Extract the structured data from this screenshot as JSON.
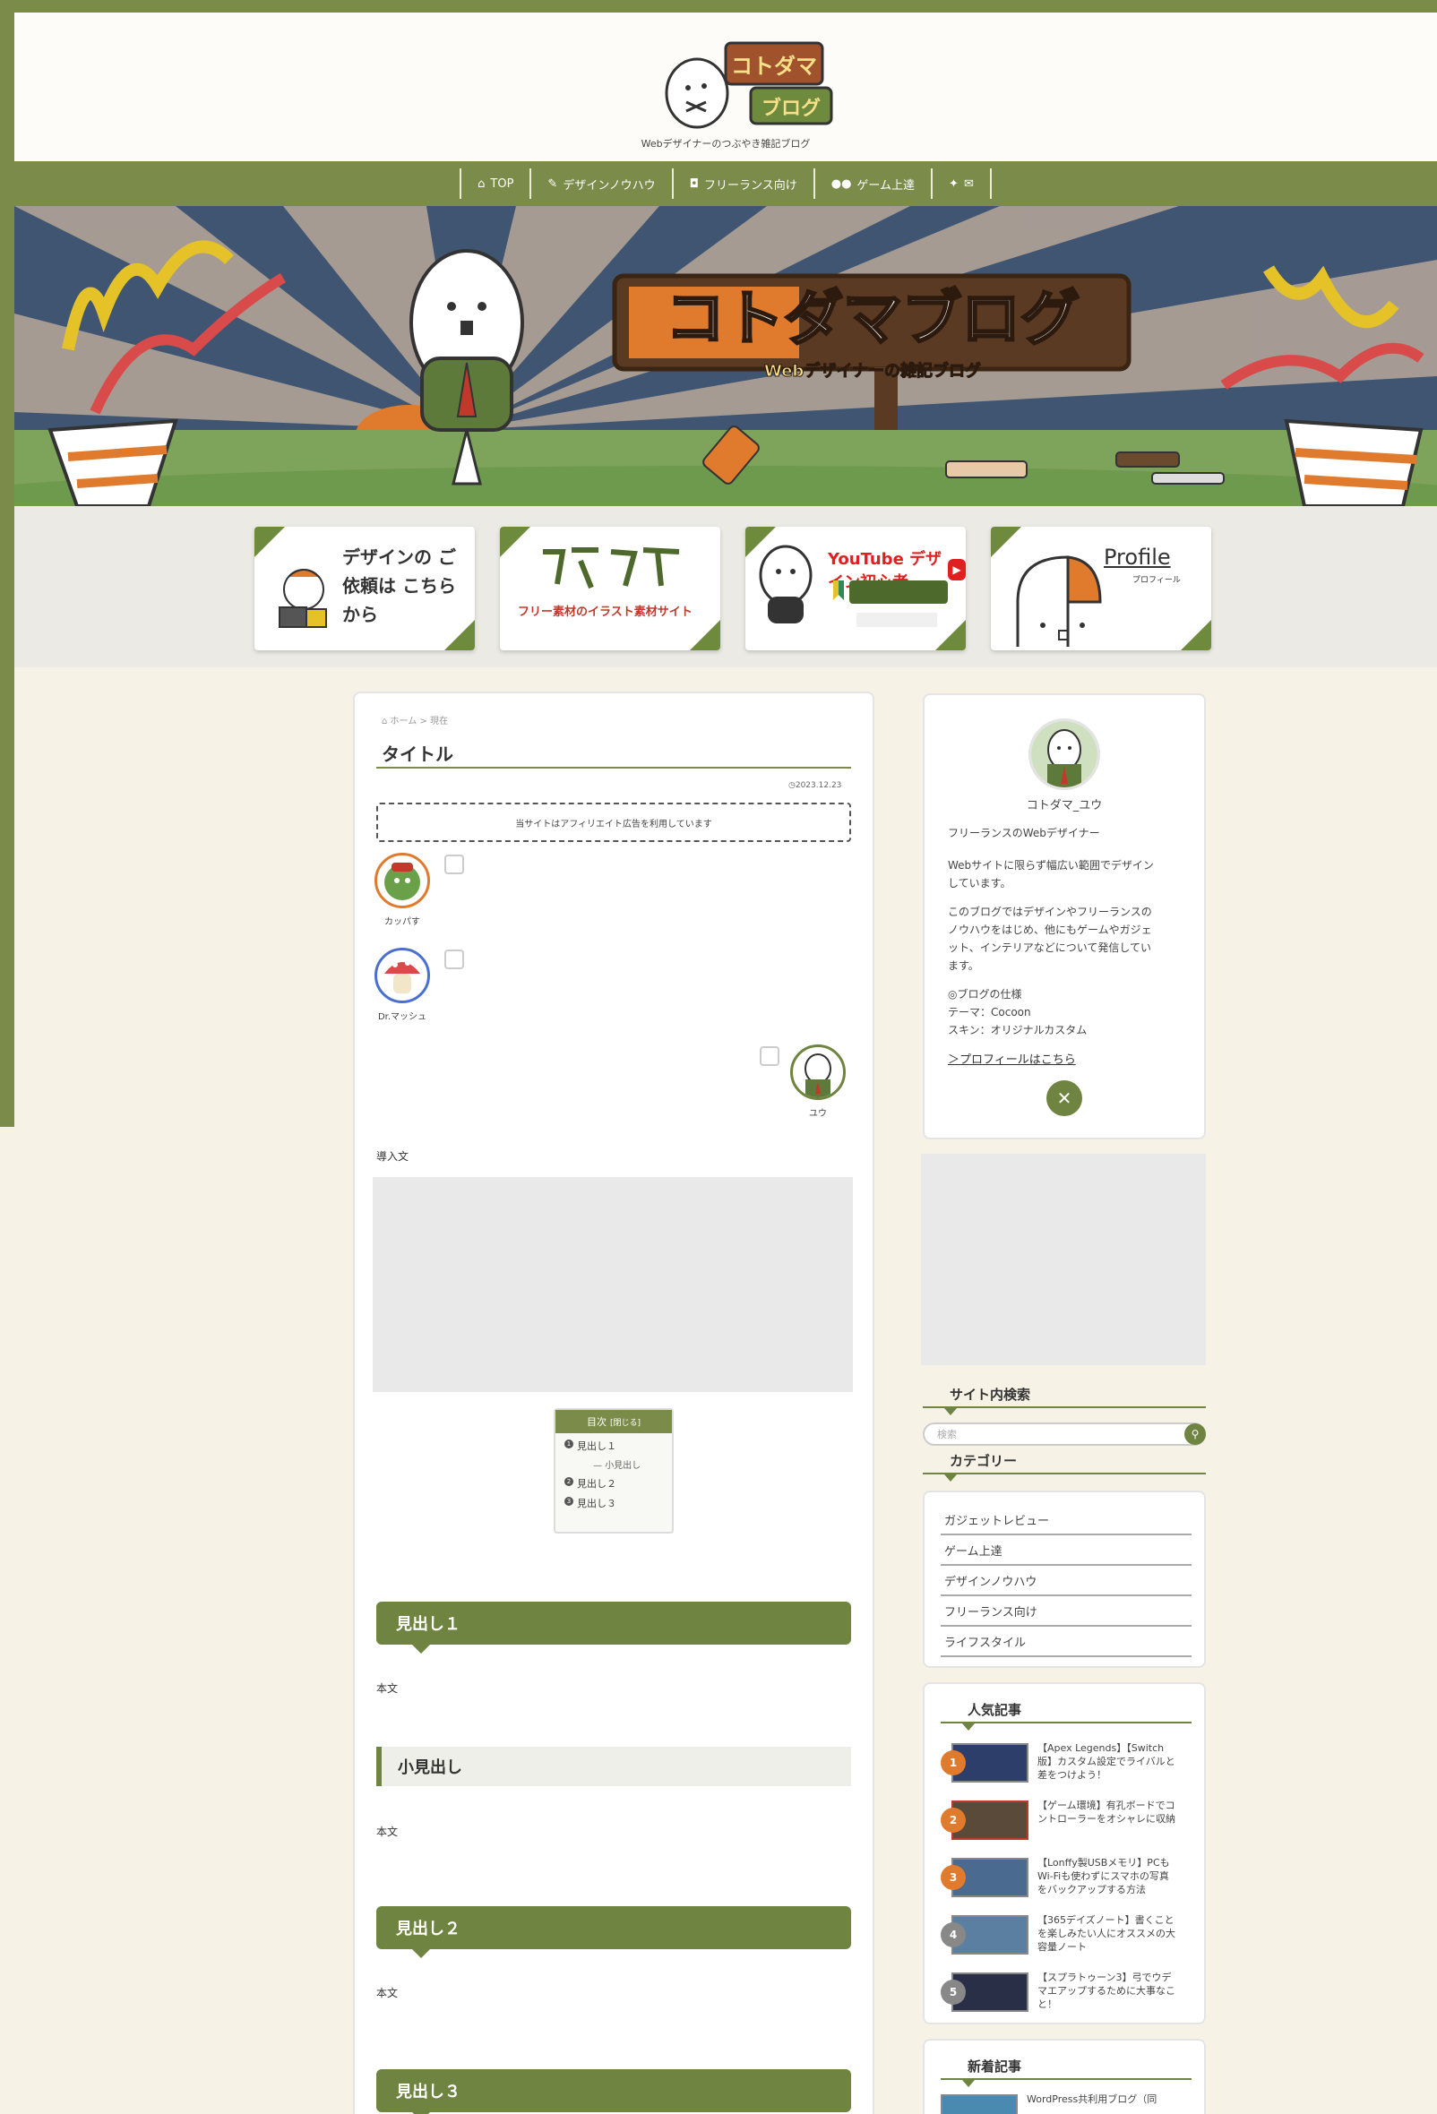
{
  "header": {
    "logo_text": "コトダマ ブログ",
    "tagline": "Webデザイナーのつぶやき雑記ブログ"
  },
  "nav": {
    "items": [
      {
        "label": "TOP",
        "icon": "home-icon"
      },
      {
        "label": "デザインノウハウ",
        "icon": "pencil-icon"
      },
      {
        "label": "フリーランス向け",
        "icon": "camera-icon"
      },
      {
        "label": "ゲーム上達",
        "icon": "gamepad-icon"
      }
    ],
    "social_icons": [
      "twitter-icon",
      "mail-icon"
    ]
  },
  "hero": {
    "sign_title": "コトダマブログ",
    "sign_subtitle": "Webデザイナーの雑記ブログ"
  },
  "banners": [
    {
      "text": "デザインの ご依頼は こちらから"
    },
    {
      "text": "フリー素材のイラスト素材サイト"
    },
    {
      "text": "YouTube デザイン初心者"
    },
    {
      "text": "Profile",
      "sub": "プロフィール"
    }
  ],
  "article": {
    "breadcrumb": "ホーム > 現在",
    "title": "タイトル",
    "date": "2023.12.23",
    "affiliate_notice": "当サイトはアフィリエイト広告を利用しています",
    "speakers": [
      {
        "name": "カッパす"
      },
      {
        "name": "Dr.マッシュ"
      },
      {
        "name": "ユウ"
      }
    ],
    "intro_label": "導入文",
    "toc": {
      "title": "目次",
      "toggle": "[閉じる]",
      "items": [
        {
          "num": "1",
          "label": "見出し１"
        },
        {
          "sub": "小見出し"
        },
        {
          "num": "2",
          "label": "見出し２"
        },
        {
          "num": "3",
          "label": "見出し３"
        }
      ]
    },
    "sections": [
      {
        "heading": "見出し１",
        "body": "本文"
      },
      {
        "subheading": "小見出し",
        "body": "本文"
      },
      {
        "heading": "見出し２",
        "body": "本文"
      },
      {
        "heading": "見出し３"
      }
    ]
  },
  "sidebar": {
    "profile": {
      "name": "コトダマ_ユウ",
      "role": "フリーランスのWebデザイナー",
      "p1_l1": "Webサイトに限らず幅広い範囲でデザイン",
      "p1_l2": "しています。",
      "p2_l1": "このブログではデザインやフリーランスの",
      "p2_l2": "ノウハウをはじめ、他にもゲームやガジェ",
      "p2_l3": "ット、インテリアなどについて発信してい",
      "p2_l4": "ます。",
      "spec_title": "◎ブログの仕様",
      "spec_theme": "テーマ：Cocoon",
      "spec_skin": "スキン：オリジナルカスタム",
      "link": "＞プロフィールはこちら"
    },
    "search": {
      "title": "サイト内検索",
      "placeholder": "検索"
    },
    "categories": {
      "title": "カテゴリー",
      "items": [
        "ガジェットレビュー",
        "ゲーム上達",
        "デザインノウハウ",
        "フリーランス向け",
        "ライフスタイル"
      ]
    },
    "popular": {
      "title": "人気記事",
      "items": [
        {
          "rank": "1",
          "l1": "【Apex Legends】【Switch",
          "l2": "版】カスタム設定でライバルと",
          "l3": "差をつけよう！"
        },
        {
          "rank": "2",
          "l1": "【ゲーム環境】有孔ボードでコ",
          "l2": "ントローラーをオシャレに収納",
          "l3": ""
        },
        {
          "rank": "3",
          "l1": "【Lonffy製USBメモリ】PCも",
          "l2": "Wi-Fiも使わずにスマホの写真",
          "l3": "をバックアップする方法"
        },
        {
          "rank": "4",
          "l1": "【365デイズノート】書くこと",
          "l2": "を楽しみたい人にオススメの大",
          "l3": "容量ノート"
        },
        {
          "rank": "5",
          "l1": "【スプラトゥーン3】弓でウデ",
          "l2": "マエアップするために大事なこ",
          "l3": "と！"
        }
      ],
      "rank_colors": [
        "#e07b2e",
        "#e07b2e",
        "#e07b2e",
        "#888888",
        "#888888"
      ]
    },
    "new_posts": {
      "title": "新着記事",
      "first": "WordPress共利用ブログ（同"
    }
  },
  "colors": {
    "accent": "#6f8441",
    "frame": "#7a8b4a",
    "orange": "#e07b2e"
  }
}
